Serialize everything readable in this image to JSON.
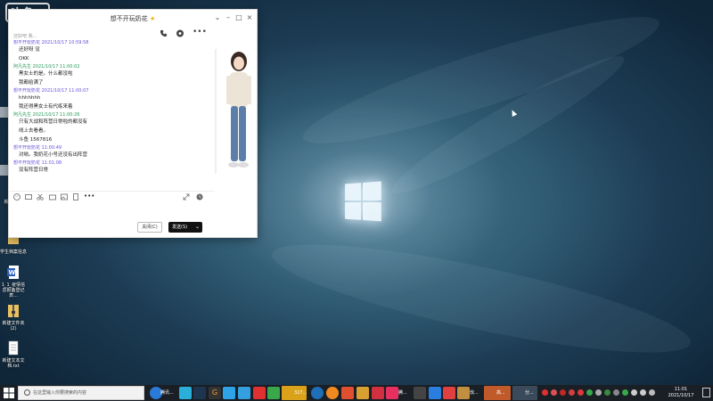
{
  "watermark": {
    "text": "斗鱼"
  },
  "desktop": {
    "icons": [
      {
        "label": "学生档案信息"
      },
      {
        "label": "1_1_疫情信息报备登记表..."
      },
      {
        "label": "新建文件夹(2)"
      },
      {
        "label": "新建文本文档.txt"
      },
      {
        "label": "新"
      }
    ]
  },
  "chat": {
    "title": "想不开玩奶花",
    "truncated_top": "还好吧 我...",
    "messages": [
      {
        "sender": "想不开玩奶花",
        "time": "2021/10/17 10:59:58",
        "lines": [
          "还好呀 没",
          "OKK"
        ],
        "color": "purple"
      },
      {
        "sender": "阿凡先生",
        "time": "2021/10/17 11:00:02",
        "lines": [
          "黑女士的是。什么都没啦",
          "我都给满了"
        ],
        "color": "green"
      },
      {
        "sender": "想不开玩奶花",
        "time": "2021/10/17 11:00:07",
        "lines": [
          "hhhhhhh",
          "我还得黑女士有代练来着"
        ],
        "color": "purple"
      },
      {
        "sender": "阿凡先生",
        "time": "2021/10/17 11:00:26",
        "lines": [
          "只有大战和阵营日常啦的都没有",
          "线上去看看。",
          "斗鱼 1567816"
        ],
        "color": "green"
      },
      {
        "sender": "想不开玩奶花",
        "time": "11:00:49",
        "lines": [
          "对呦。我奶花小号还没有出阵营"
        ],
        "color": "purple"
      },
      {
        "sender": "想不开玩奶花",
        "time": "11:01:08",
        "lines": [
          "没有阵营日常"
        ],
        "color": "purple"
      }
    ],
    "close_label": "关闭(C)",
    "send_label": "发送(S)"
  },
  "taskbar": {
    "search_placeholder": "在这里输入你要搜索的内容",
    "apps": [
      {
        "label": "腾讯..."
      },
      {
        "label": "327..."
      },
      {
        "label": "腾..."
      },
      {
        "label": "伐..."
      },
      {
        "label": "高..."
      },
      {
        "label": "分..."
      }
    ],
    "time": "11:01",
    "date": "2021/10/17"
  },
  "colors": {
    "accent_purple": "#6b4fd8",
    "accent_green": "#2a9a5a",
    "send_button": "#111111",
    "taskbar": "#1a1f26"
  }
}
